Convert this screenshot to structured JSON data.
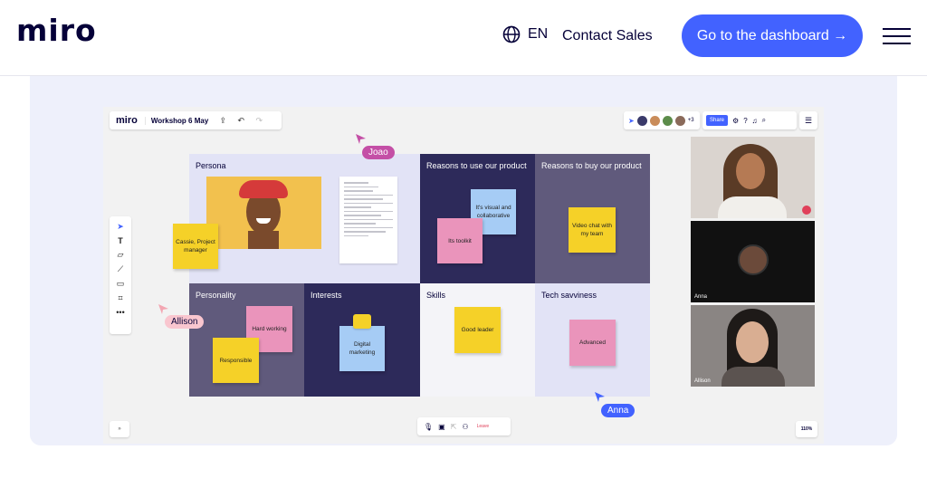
{
  "header": {
    "logo": "miro",
    "language": "EN",
    "contact_sales": "Contact Sales",
    "cta": "Go to the dashboard →"
  },
  "board": {
    "logo": "miro",
    "name": "Workshop 6 May",
    "extra_users": "+3",
    "share": "Share",
    "zoom": "110%",
    "collapse": "»",
    "leave": "Leave",
    "cells": {
      "persona": "Persona",
      "reasons_use": "Reasons to use our product",
      "reasons_buy": "Reasons to buy our product",
      "personality": "Personality",
      "interests": "Interests",
      "skills": "Skills",
      "tech": "Tech savviness"
    },
    "stickies": {
      "cassie": "Cassie, Project manager",
      "visual": "It's visual and collaborative",
      "toolkit": "Its toolkit",
      "video_chat": "Video chat with my team",
      "hard_working": "Hard working",
      "responsible": "Responsible",
      "digital": "Digital marketing",
      "good_leader": "Good leader",
      "advanced": "Advanced"
    },
    "cursors": {
      "joao": "Joao",
      "allison": "Allison",
      "anna": "Anna"
    },
    "videos": {
      "anna": "Anna",
      "allison": "Allison"
    }
  },
  "colors": {
    "brand": "#4262ff",
    "cell_dark": "#2d2a5a",
    "cell_mid": "#605a7c",
    "cell_light": "#e2e3f6"
  }
}
